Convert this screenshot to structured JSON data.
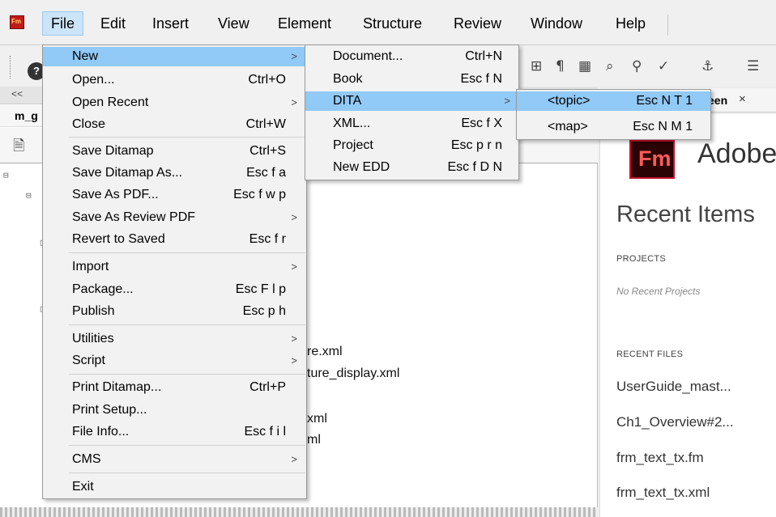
{
  "app": {
    "icon_text": "Fm"
  },
  "menubar": {
    "items": [
      {
        "label": "File",
        "active": true
      },
      {
        "label": "Edit"
      },
      {
        "label": "Insert"
      },
      {
        "label": "View"
      },
      {
        "label": "Element"
      },
      {
        "label": "Structure"
      },
      {
        "label": "Review"
      },
      {
        "label": "Window"
      },
      {
        "label": "Help"
      }
    ]
  },
  "left_pane": {
    "collapse_glyph": "<<",
    "title": "m_g",
    "behind_items": [
      "re.xml",
      "ture_display.xml",
      "xml",
      "ml"
    ]
  },
  "right_pane": {
    "tab_label": "een",
    "tab_close": "×",
    "logo_text": "Fm",
    "brand_text": "Adobe",
    "recent_title": "Recent Items",
    "projects_label": "PROJECTS",
    "no_projects": "No Recent Projects",
    "recent_files_label": "RECENT FILES",
    "recent_files": [
      "UserGuide_mast...",
      "Ch1_Overview#2...",
      "frm_text_tx.fm",
      "frm_text_tx.xml"
    ]
  },
  "file_menu": {
    "items": [
      {
        "label": "New",
        "shortcut": "",
        "submenu": true,
        "highlighted": true
      },
      {
        "label": "Open...",
        "shortcut": "Ctrl+O"
      },
      {
        "label": "Open Recent",
        "shortcut": "",
        "submenu": true
      },
      {
        "label": "Close",
        "shortcut": "Ctrl+W"
      },
      {
        "label": "Save Ditamap",
        "shortcut": "Ctrl+S"
      },
      {
        "label": "Save Ditamap As...",
        "shortcut": "Esc f a"
      },
      {
        "label": "Save As PDF...",
        "shortcut": "Esc f w p"
      },
      {
        "label": "Save As Review PDF",
        "shortcut": "",
        "submenu": true
      },
      {
        "label": "Revert to Saved",
        "shortcut": "Esc f r"
      },
      {
        "label": "Import",
        "shortcut": "",
        "submenu": true
      },
      {
        "label": "Package...",
        "shortcut": "Esc F l p"
      },
      {
        "label": "Publish",
        "shortcut": "Esc p h"
      },
      {
        "label": "Utilities",
        "shortcut": "",
        "submenu": true
      },
      {
        "label": "Script",
        "shortcut": "",
        "submenu": true
      },
      {
        "label": "Print Ditamap...",
        "shortcut": "Ctrl+P"
      },
      {
        "label": "Print Setup...",
        "shortcut": ""
      },
      {
        "label": "File Info...",
        "shortcut": "Esc f i l"
      },
      {
        "label": "CMS",
        "shortcut": "",
        "submenu": true
      },
      {
        "label": "Exit",
        "shortcut": ""
      }
    ]
  },
  "new_menu": {
    "items": [
      {
        "label": "Document...",
        "shortcut": "Ctrl+N"
      },
      {
        "label": "Book",
        "shortcut": "Esc f N"
      },
      {
        "label": "DITA",
        "shortcut": "",
        "submenu": true,
        "highlighted": true
      },
      {
        "label": "XML...",
        "shortcut": "Esc f X"
      },
      {
        "label": "Project",
        "shortcut": "Esc p r n"
      },
      {
        "label": "New EDD",
        "shortcut": "Esc f D N"
      }
    ]
  },
  "dita_menu": {
    "items": [
      {
        "label": "<topic>",
        "shortcut": "Esc N T 1",
        "highlighted": true
      },
      {
        "label": "<map>",
        "shortcut": "Esc N M 1"
      }
    ]
  },
  "submenu_arrow": ">",
  "colors": {
    "highlight": "#91c9f7",
    "menu_bg": "#f2f2f2",
    "menubar_active": "#cce4f7",
    "brand_red": "#c8102e"
  }
}
